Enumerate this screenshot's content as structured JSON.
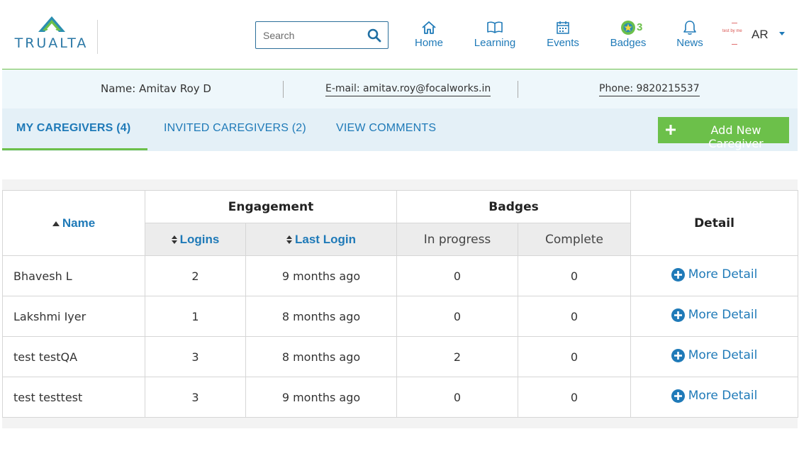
{
  "brand": {
    "logo_text": "TRUALTA"
  },
  "search": {
    "placeholder": "Search"
  },
  "nav": {
    "home": "Home",
    "learning": "Learning",
    "events": "Events",
    "badges": "Badges",
    "badges_count": "3",
    "news": "News"
  },
  "user": {
    "avatar_alt": "test by me",
    "initials": "AR"
  },
  "profile": {
    "name": "Name: Amitav Roy D",
    "email": "E-mail: amitav.roy@focalworks.in",
    "phone": "Phone: 9820215537"
  },
  "tabs": [
    {
      "label": "MY CAREGIVERS (4)"
    },
    {
      "label": "INVITED CAREGIVERS (2)"
    },
    {
      "label": "VIEW COMMENTS"
    }
  ],
  "actions": {
    "add_caregiver": "Add New Caregiver"
  },
  "table": {
    "headers": {
      "name": "Name",
      "engagement": "Engagement",
      "badges": "Badges",
      "detail": "Detail",
      "logins": "Logins",
      "last_login": "Last Login",
      "in_progress": "In progress",
      "complete": "Complete"
    },
    "rows": [
      {
        "name": "Bhavesh L",
        "logins": "2",
        "last_login": "9 months ago",
        "in_progress": "0",
        "complete": "0",
        "detail": "More Detail"
      },
      {
        "name": "Lakshmi Iyer",
        "logins": "1",
        "last_login": "8 months ago",
        "in_progress": "0",
        "complete": "0",
        "detail": "More Detail"
      },
      {
        "name": "test testQA",
        "logins": "3",
        "last_login": "8 months ago",
        "in_progress": "2",
        "complete": "0",
        "detail": "More Detail"
      },
      {
        "name": "test testtest",
        "logins": "3",
        "last_login": "9 months ago",
        "in_progress": "0",
        "complete": "0",
        "detail": "More Detail"
      }
    ]
  },
  "colors": {
    "brand_blue": "#1f7ab8",
    "accent_green": "#6cc04a",
    "profile_bg": "#eef7fb",
    "tabs_bg": "#e4f0f7"
  }
}
